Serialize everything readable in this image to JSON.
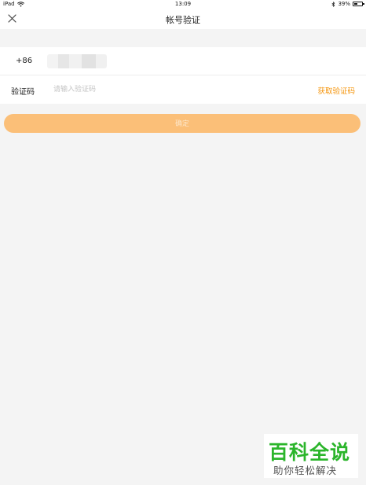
{
  "status_bar": {
    "device": "iPad",
    "time": "13:09",
    "battery": "39%",
    "battery_level": 0.39,
    "icons": [
      "wifi-icon",
      "bluetooth-icon",
      "battery-icon"
    ]
  },
  "nav": {
    "title": "帐号验证",
    "close_icon": "close-icon"
  },
  "form": {
    "country_code": "+86",
    "code_label": "验证码",
    "code_placeholder": "请输入验证码",
    "code_value": "",
    "get_code_label": "获取验证码"
  },
  "confirm_label": "确定",
  "watermark": {
    "logo": "百科全说",
    "slogan": "助你轻松解决"
  },
  "colors": {
    "accent": "#f5940a",
    "button_bg": "#fbbf78",
    "watermark_green": "#2bb52b",
    "page_bg": "#f4f4f4"
  }
}
